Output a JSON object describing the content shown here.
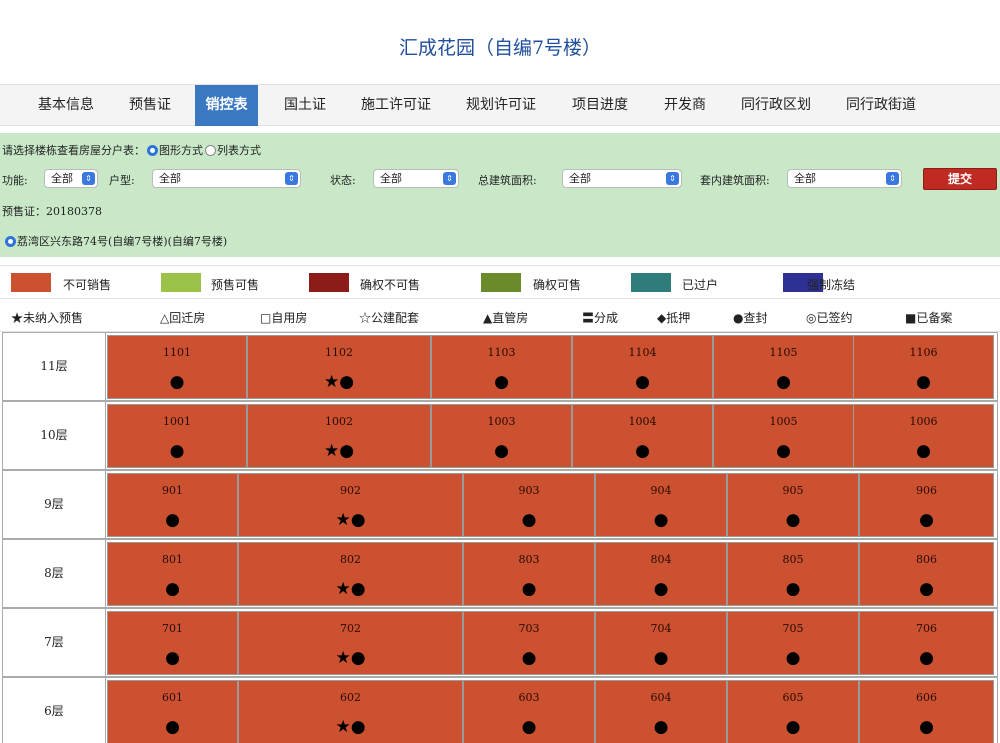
{
  "title": "汇成花园（自编7号楼）",
  "tabs": [
    {
      "label": "基本信息",
      "active": false
    },
    {
      "label": "预售证",
      "active": false
    },
    {
      "label": "销控表",
      "active": true
    },
    {
      "label": "国土证",
      "active": false
    },
    {
      "label": "施工许可证",
      "active": false
    },
    {
      "label": "规划许可证",
      "active": false
    },
    {
      "label": "项目进度",
      "active": false
    },
    {
      "label": "开发商",
      "active": false
    },
    {
      "label": "同行政区划",
      "active": false
    },
    {
      "label": "同行政街道",
      "active": false
    }
  ],
  "filter": {
    "prompt": "请选择楼栋查看房屋分户表：",
    "view_graphic": "图形方式",
    "view_list": "列表方式",
    "function_label": "功能:",
    "function_value": "全部",
    "type_label": "户型:",
    "type_value": "全部",
    "status_label": "状态:",
    "status_value": "全部",
    "total_area_label": "总建筑面积:",
    "total_area_value": "全部",
    "inner_area_label": "套内建筑面积:",
    "inner_area_value": "全部",
    "submit_label": "提交",
    "presale_cert": "预售证：20180378",
    "building": "荔湾区兴东路74号(自编7号楼)(自编7号楼)"
  },
  "legend": [
    {
      "label": "不可销售",
      "color": "#cb5130"
    },
    {
      "label": "预售可售",
      "color": "#9cc24a"
    },
    {
      "label": "确权不可售",
      "color": "#8b1c17"
    },
    {
      "label": "确权可售",
      "color": "#6a8a2c"
    },
    {
      "label": "已过户",
      "color": "#2e7d7c"
    },
    {
      "label": "强制冻结",
      "color": "#2e3193"
    }
  ],
  "marks": [
    "★未纳入预售",
    "△回迁房",
    "□自用房",
    "☆公建配套",
    "▲直管房",
    "〓分成",
    "◆抵押",
    "●查封",
    "◎已签约",
    "■已备案"
  ],
  "floors": [
    {
      "label": "11层",
      "units": [
        {
          "num": "1101",
          "mark": "●"
        },
        {
          "num": "1102",
          "mark": "★●"
        },
        {
          "num": "1103",
          "mark": "●"
        },
        {
          "num": "1104",
          "mark": "●"
        },
        {
          "num": "1105",
          "mark": "●"
        },
        {
          "num": "1106",
          "mark": "●"
        }
      ]
    },
    {
      "label": "10层",
      "units": [
        {
          "num": "1001",
          "mark": "●"
        },
        {
          "num": "1002",
          "mark": "★●"
        },
        {
          "num": "1003",
          "mark": "●"
        },
        {
          "num": "1004",
          "mark": "●"
        },
        {
          "num": "1005",
          "mark": "●"
        },
        {
          "num": "1006",
          "mark": "●"
        }
      ]
    },
    {
      "label": "9层",
      "units": [
        {
          "num": "901",
          "mark": "●"
        },
        {
          "num": "902",
          "mark": "★●"
        },
        {
          "num": "903",
          "mark": "●"
        },
        {
          "num": "904",
          "mark": "●"
        },
        {
          "num": "905",
          "mark": "●"
        },
        {
          "num": "906",
          "mark": "●"
        }
      ]
    },
    {
      "label": "8层",
      "units": [
        {
          "num": "801",
          "mark": "●"
        },
        {
          "num": "802",
          "mark": "★●"
        },
        {
          "num": "803",
          "mark": "●"
        },
        {
          "num": "804",
          "mark": "●"
        },
        {
          "num": "805",
          "mark": "●"
        },
        {
          "num": "806",
          "mark": "●"
        }
      ]
    },
    {
      "label": "7层",
      "units": [
        {
          "num": "701",
          "mark": "●"
        },
        {
          "num": "702",
          "mark": "★●"
        },
        {
          "num": "703",
          "mark": "●"
        },
        {
          "num": "704",
          "mark": "●"
        },
        {
          "num": "705",
          "mark": "●"
        },
        {
          "num": "706",
          "mark": "●"
        }
      ]
    },
    {
      "label": "6层",
      "units": [
        {
          "num": "601",
          "mark": "●"
        },
        {
          "num": "602",
          "mark": "★●"
        },
        {
          "num": "603",
          "mark": "●"
        },
        {
          "num": "604",
          "mark": "●"
        },
        {
          "num": "605",
          "mark": "●"
        },
        {
          "num": "606",
          "mark": "●"
        }
      ]
    }
  ]
}
